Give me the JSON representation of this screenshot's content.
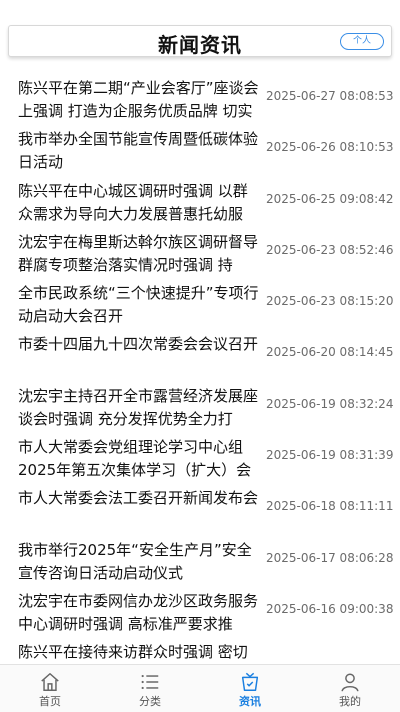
{
  "header": {
    "title": "新闻资讯",
    "personal_button": "个人"
  },
  "news": [
    {
      "title": "陈兴平在第二期“产业会客厅”座谈会上强调 打造为企服务优质品牌 切实",
      "time": "2025-06-27 08:08:53"
    },
    {
      "title": "我市举办全国节能宣传周暨低碳体验日活动",
      "time": "2025-06-26 08:10:53"
    },
    {
      "title": "陈兴平在中心城区调研时强调 以群众需求为导向大力发展普惠托幼服",
      "time": "2025-06-25 09:08:42"
    },
    {
      "title": "沈宏宇在梅里斯达斡尔族区调研督导群腐专项整治落实情况时强调 持",
      "time": "2025-06-23 08:52:46"
    },
    {
      "title": "全市民政系统“三个快速提升”专项行动启动大会召开",
      "time": "2025-06-23 08:15:20"
    },
    {
      "title": "市委十四届九十四次常委会会议召开",
      "time": "2025-06-20 08:14:45"
    },
    {
      "title": "沈宏宇主持召开全市露营经济发展座谈会时强调 充分发挥优势全力打",
      "time": "2025-06-19 08:32:24"
    },
    {
      "title": "市人大常委会党组理论学习中心组2025年第五次集体学习（扩大）会",
      "time": "2025-06-19 08:31:39"
    },
    {
      "title": "市人大常委会法工委召开新闻发布会",
      "time": "2025-06-18 08:11:11"
    },
    {
      "title": "我市举行2025年“安全生产月”安全宣传咨询日活动启动仪式",
      "time": "2025-06-17 08:06:28"
    },
    {
      "title": "沈宏宇在市委网信办龙沙区政务服务中心调研时强调 高标准严要求推",
      "time": "2025-06-16 09:00:38"
    },
    {
      "title": "陈兴平在接待来访群众时强调 密切",
      "time": ""
    }
  ],
  "tabs": [
    {
      "label": "首页",
      "icon": "home-icon",
      "active": false
    },
    {
      "label": "分类",
      "icon": "list-icon",
      "active": false
    },
    {
      "label": "资讯",
      "icon": "news-icon",
      "active": true
    },
    {
      "label": "我的",
      "icon": "user-icon",
      "active": false
    }
  ],
  "colors": {
    "accent": "#1a7fe0",
    "button_border": "#3a8ee6",
    "time_text": "#6b6b6b"
  }
}
